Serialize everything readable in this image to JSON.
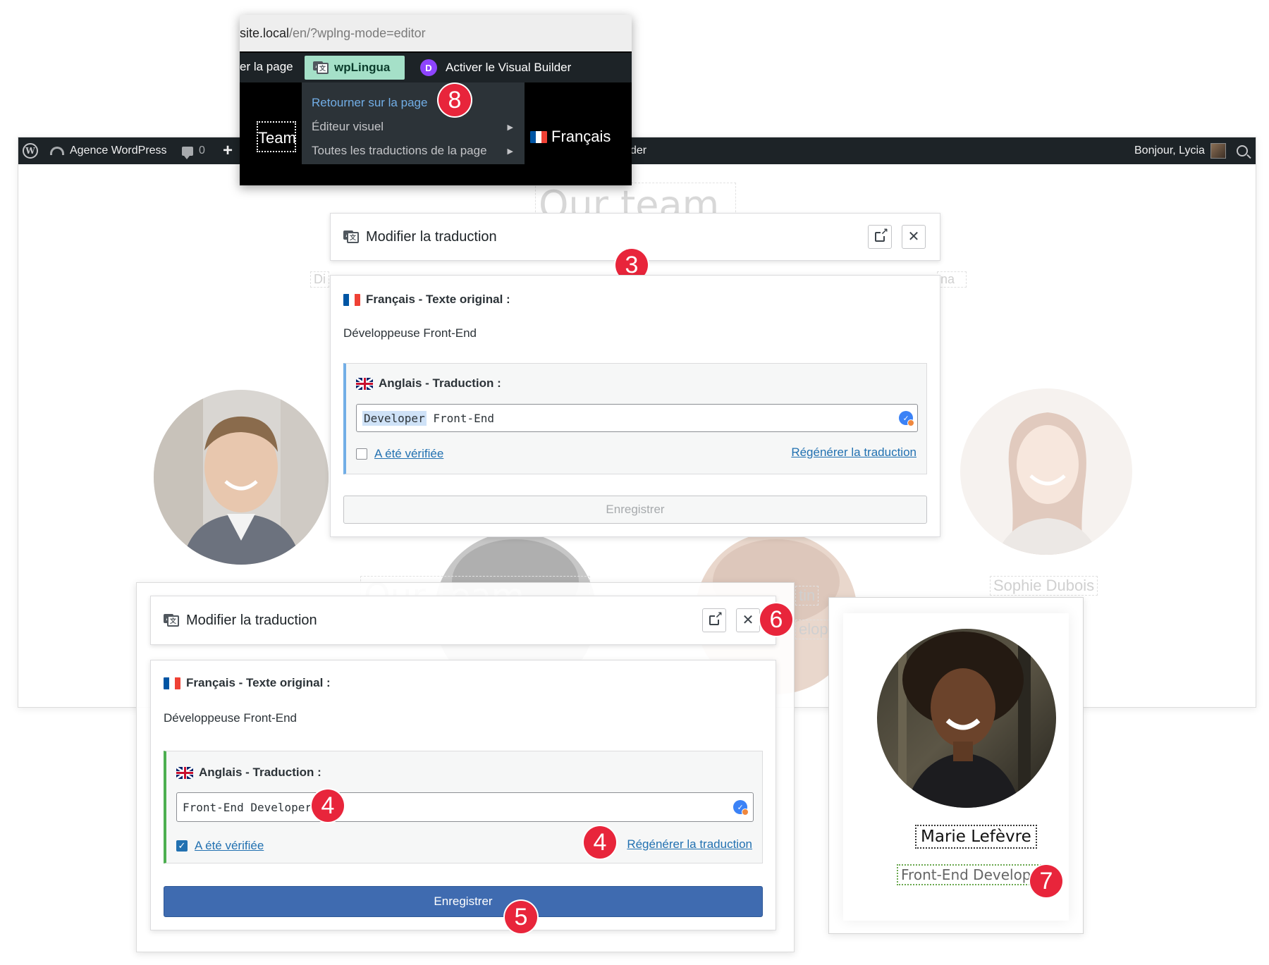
{
  "wp": {
    "site_name": "Agence WordPress",
    "comments_count": "0",
    "plus": "+",
    "greeting": "Bonjour, Lycia",
    "builder_fragment": "der",
    "heading_ghost": "Our team",
    "heading_ghost_2": "Our team",
    "name_ghost_sophie": "Sophie Dubois",
    "fragment_tin": "tin",
    "fragment_elope": "elope",
    "fragment_di": "Di",
    "fragment_na": "na"
  },
  "popup": {
    "url_host": "site.local",
    "url_path": "/en/?wplng-mode=editor",
    "toolbar_left": "er la page",
    "wplingua_label": "wpLingua",
    "visual_builder_label": "Activer le Visual Builder",
    "divi_letter": "D",
    "team_label": "Team",
    "language_label": "Français",
    "menu": [
      {
        "label": "Retourner sur la page"
      },
      {
        "label": "Éditeur visuel"
      },
      {
        "label": "Toutes les traductions de la page"
      }
    ]
  },
  "modal_top": {
    "title": "Modifier la traduction",
    "original_label": "Français - Texte original :",
    "original_text": "Développeuse Front-End",
    "translation_label": "Anglais - Traduction :",
    "input_selected": "Developer",
    "input_rest": " Front-End",
    "verified_label": "A été vérifiée",
    "verified": false,
    "regenerate_label": "Régénérer la traduction",
    "save_label": "Enregistrer"
  },
  "modal_bottom": {
    "title": "Modifier la traduction",
    "original_label": "Français - Texte original :",
    "original_text": "Développeuse Front-End",
    "translation_label": "Anglais - Traduction :",
    "input_value": "Front-End Developer",
    "verified_label": "A été vérifiée",
    "verified": true,
    "regenerate_label": "Régénérer la traduction",
    "save_label": "Enregistrer"
  },
  "card": {
    "name": "Marie Lefèvre",
    "role": "Front-End Developer"
  },
  "steps": {
    "s3": "3",
    "s4a": "4",
    "s4b": "4",
    "s5": "5",
    "s6": "6",
    "s7": "7",
    "s8": "8"
  },
  "colors": {
    "admin_bar": "#1d2327",
    "wplingua_green": "#a5e0c8",
    "primary_blue": "#3f6bb0",
    "link_blue": "#2271b1",
    "step_red": "#e8253b",
    "verify_badge": "#3b82f6",
    "divi_purple": "#8e44ff"
  },
  "icons": [
    "wordpress-icon",
    "dashboard-icon",
    "comment-icon",
    "plus-icon",
    "search-icon",
    "translate-icon",
    "external-link-icon",
    "close-icon",
    "flag-fr-icon",
    "flag-uk-icon",
    "verify-badge-icon",
    "checkbox-icon",
    "caret-right-icon",
    "divi-icon",
    "avatar-icon"
  ]
}
